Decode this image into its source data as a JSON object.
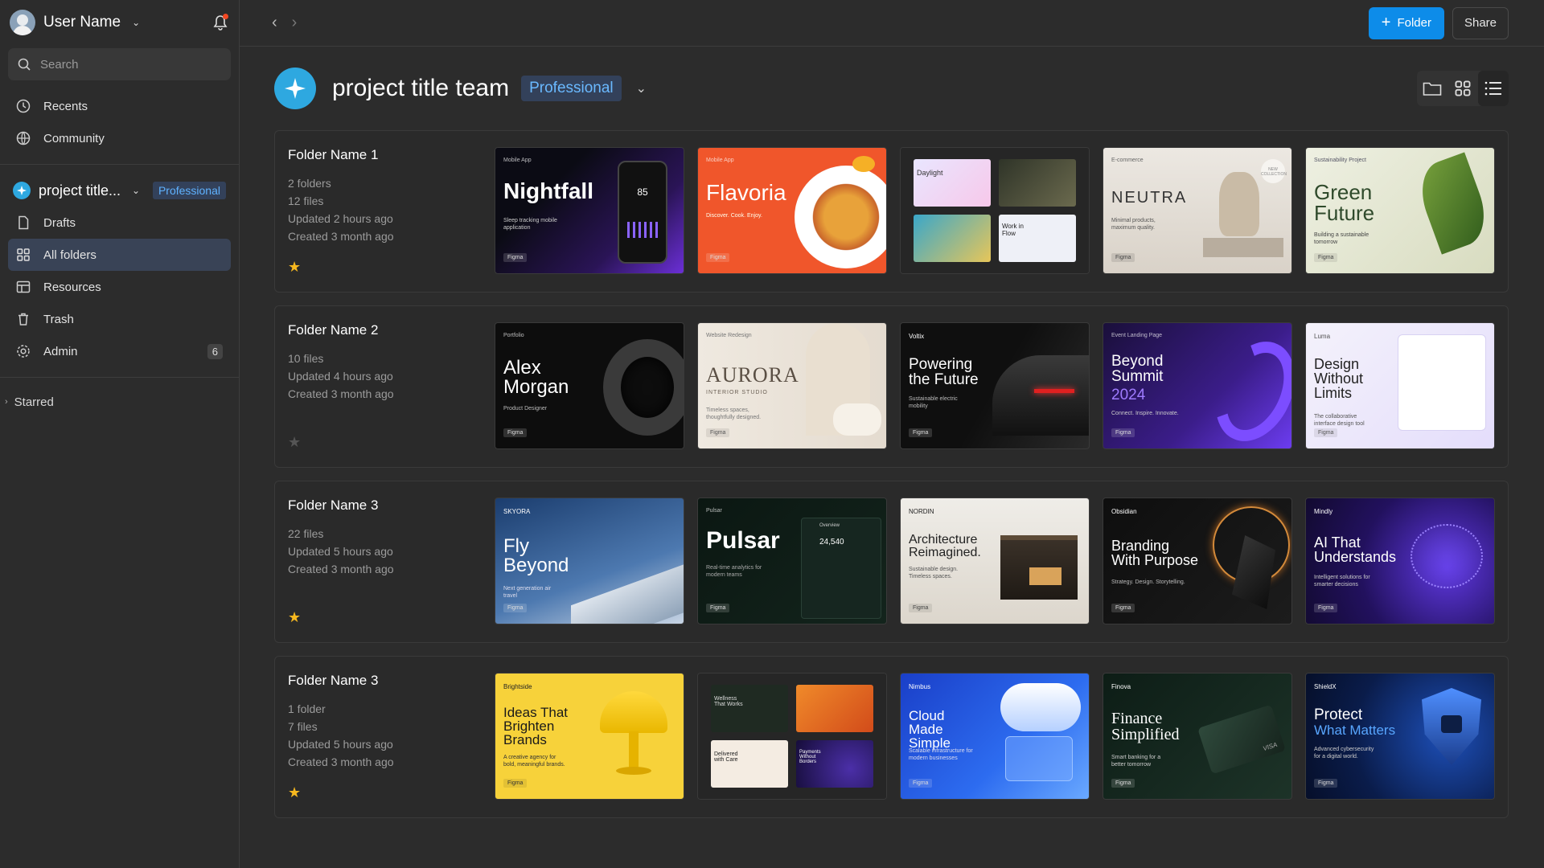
{
  "user": {
    "name": "User Name"
  },
  "sidebar": {
    "search_placeholder": "Search",
    "items_top": [
      {
        "label": "Recents",
        "icon": "clock-icon"
      },
      {
        "label": "Community",
        "icon": "globe-icon"
      }
    ],
    "team": {
      "name": "project title...",
      "badge": "Professional"
    },
    "items": [
      {
        "label": "Drafts",
        "icon": "file-icon"
      },
      {
        "label": "All folders",
        "icon": "grid-icon",
        "active": true
      },
      {
        "label": "Resources",
        "icon": "layout-icon"
      },
      {
        "label": "Trash",
        "icon": "trash-icon"
      },
      {
        "label": "Admin",
        "icon": "gear-icon",
        "count": "6"
      }
    ],
    "starred": "Starred"
  },
  "topbar": {
    "folder_label": "Folder",
    "share_label": "Share"
  },
  "header": {
    "title": "project title team",
    "badge": "Professional"
  },
  "folders": [
    {
      "name": "Folder Name 1",
      "meta": [
        "2 folders",
        "12 files",
        "Updated 2 hours ago",
        "Created 3 month ago"
      ],
      "starred": true,
      "thumbs": [
        {
          "label": "Mobile App",
          "title": "Nightfall",
          "sub": "Sleep tracking mobile application",
          "stat": "85"
        },
        {
          "label": "Mobile App",
          "title": "Flavoria",
          "sub": "Discover. Cook. Enjoy."
        },
        {
          "grid": [
            "Daylight",
            "",
            "",
            "Work in Flow"
          ]
        },
        {
          "label": "E-commerce",
          "title": "NEUTRA",
          "sub": "Minimal products, maximum quality.",
          "tag": "NEW COLLECTION"
        },
        {
          "label": "Sustainability Project",
          "title": "Green Future",
          "sub": "Building a sustainable tomorrow"
        }
      ]
    },
    {
      "name": "Folder Name 2",
      "meta": [
        "10 files",
        "Updated 4 hours ago",
        "Created 3 month ago"
      ],
      "starred": false,
      "thumbs": [
        {
          "label": "Portfolio",
          "title": "Alex Morgan",
          "sub": "Product Designer"
        },
        {
          "label": "Website Redesign",
          "title": "AURORA",
          "sub": "INTERIOR STUDIO",
          "sub2": "Timeless spaces, thoughtfully designed."
        },
        {
          "label": "Voltix",
          "title": "Powering the Future",
          "sub": "Sustainable electric mobility"
        },
        {
          "label": "Event Landing Page",
          "title": "Beyond Summit",
          "year": "2024",
          "sub": "Connect. Inspire. Innovate."
        },
        {
          "label": "Luma",
          "title": "Design Without Limits",
          "sub": "The collaborative interface design tool"
        }
      ]
    },
    {
      "name": "Folder Name 3",
      "meta": [
        "22 files",
        "Updated 5 hours ago",
        "Created 3 month ago"
      ],
      "starred": true,
      "thumbs": [
        {
          "label": "SKYORA",
          "title": "Fly Beyond",
          "sub": "Next generation air travel"
        },
        {
          "label": "Pulsar",
          "title": "Pulsar",
          "sub": "Real-time analytics for modern teams",
          "stat": "24,540",
          "stat_label": "Overview"
        },
        {
          "label": "NORDIN",
          "title": "Architecture Reimagined.",
          "sub": "Sustainable design. Timeless spaces."
        },
        {
          "label": "Obsidian",
          "title": "Branding With Purpose",
          "sub": "Strategy. Design. Storytelling."
        },
        {
          "label": "Mindly",
          "title": "AI That Understands",
          "sub": "Intelligent solutions for smarter decisions"
        }
      ]
    },
    {
      "name": "Folder Name 3",
      "meta": [
        "1 folder",
        "7 files",
        "Updated 5 hours ago",
        "Created 3 month ago"
      ],
      "starred": true,
      "thumbs": [
        {
          "label": "Brightside",
          "title": "Ideas That Brighten Brands",
          "sub": "A creative agency for bold, meaningful brands."
        },
        {
          "grid": [
            "Wellness That Works",
            "",
            "Delivered with Care",
            "Payments Without Borders"
          ]
        },
        {
          "label": "Nimbus",
          "title": "Cloud Made Simple",
          "sub": "Scalable infrastructure for modern businesses"
        },
        {
          "label": "Finova",
          "title": "Finance Simplified",
          "sub": "Smart banking for a better tomorrow",
          "tag": "VISA"
        },
        {
          "label": "ShieldX",
          "title": "Protect",
          "title2": "What Matters",
          "sub": "Advanced cybersecurity for a digital world."
        }
      ]
    }
  ],
  "figma_tag": "Figma",
  "colors": {
    "accent": "#0d8ce9",
    "star": "#f7b81f",
    "team": "#2ea8e0"
  }
}
